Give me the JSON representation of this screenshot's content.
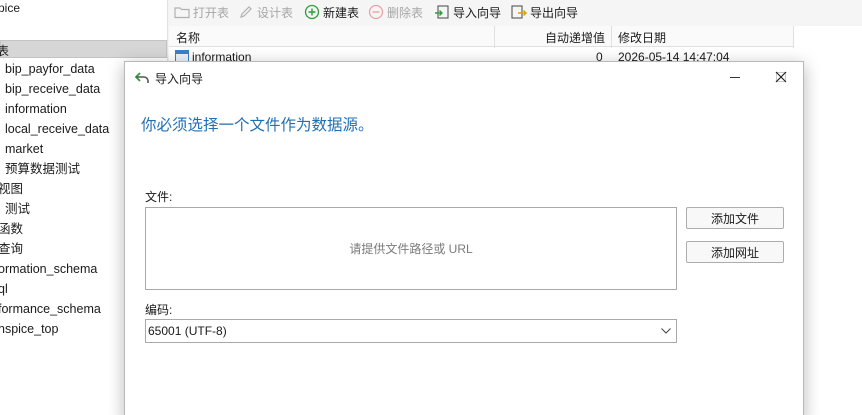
{
  "tree": {
    "db_title": "pice",
    "selected_label": "表",
    "items": [
      {
        "label": "bip_payfor_data"
      },
      {
        "label": "bip_receive_data"
      },
      {
        "label": "information"
      },
      {
        "label": "local_receive_data"
      },
      {
        "label": "market"
      },
      {
        "label": "预算数据测试"
      },
      {
        "label": "视图"
      },
      {
        "label": "测试"
      },
      {
        "label": "函数"
      },
      {
        "label": "查询"
      },
      {
        "label": "ormation_schema"
      },
      {
        "label": "ql"
      },
      {
        "label": "formance_schema"
      },
      {
        "label": "nspice_top"
      }
    ]
  },
  "toolbar": {
    "open_table": "打开表",
    "design_table": "设计表",
    "new_table": "新建表",
    "delete_table": "删除表",
    "import_wizard": "导入向导",
    "export_wizard": "导出向导"
  },
  "table": {
    "columns": [
      "名称",
      "自动递增值",
      "修改日期"
    ],
    "rows": [
      {
        "name": "information",
        "auto_increment": "0",
        "modified": "2026-05-14 14:47:04"
      }
    ]
  },
  "dialog": {
    "title": "导入向导",
    "heading": "你必须选择一个文件作为数据源。",
    "file_label": "文件:",
    "file_placeholder": "请提供文件路径或 URL",
    "add_file_button": "添加文件",
    "add_url_button": "添加网址",
    "encoding_label": "编码:",
    "encoding_value": "65001 (UTF-8)"
  },
  "colors": {
    "heading_blue": "#1f6fb5",
    "new_table_green": "#2e9e3b",
    "delete_red": "#d9534f"
  },
  "icons": {
    "open_table": "folder-open-icon",
    "design_table": "pencil-icon",
    "new_table": "plus-circle-icon",
    "delete_table": "minus-circle-icon",
    "import_wizard": "import-icon",
    "export_wizard": "export-icon",
    "dialog": "back-arrow-icon"
  }
}
